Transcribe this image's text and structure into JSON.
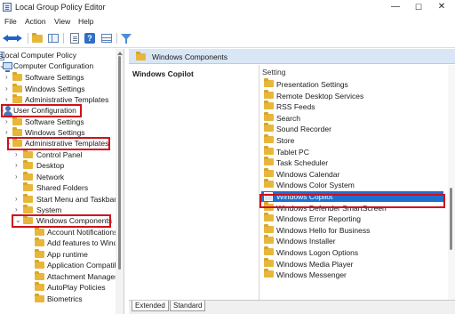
{
  "window": {
    "title": "Local Group Policy Editor",
    "minimize": "—",
    "maximize": "☐",
    "close": "✕"
  },
  "menu": [
    "File",
    "Action",
    "View",
    "Help"
  ],
  "toolbar": [
    "back-icon",
    "forward-icon",
    "folder-up-icon",
    "show-hide-tree-icon",
    "properties-icon",
    "help-icon",
    "table-view-icon",
    "filter-icon"
  ],
  "tree": {
    "root": "Local Computer Policy",
    "computer_config": "Computer Configuration",
    "cc_software": "Software Settings",
    "cc_windows": "Windows Settings",
    "cc_admin": "Administrative Templates",
    "user_config": "User Configuration",
    "uc_software": "Software Settings",
    "uc_windows": "Windows Settings",
    "uc_admin": "Administrative Templates",
    "children": [
      "Control Panel",
      "Desktop",
      "Network",
      "Shared Folders",
      "Start Menu and Taskbar",
      "System"
    ],
    "windows_components": "Windows Components",
    "wc_children": [
      "Account Notifications",
      "Add features to Windows",
      "App runtime",
      "Application Compatibility",
      "Attachment Manager",
      "AutoPlay Policies",
      "Biometrics"
    ]
  },
  "right": {
    "header_title": "Windows Components",
    "desc_title": "Windows Copilot",
    "column_header": "Setting",
    "items": [
      "Presentation Settings",
      "Remote Desktop Services",
      "RSS Feeds",
      "Search",
      "Sound Recorder",
      "Store",
      "Tablet PC",
      "Task Scheduler",
      "Windows Calendar",
      "Windows Color System",
      "Windows Copilot",
      "Windows Defender SmartScreen",
      "Windows Error Reporting",
      "Windows Hello for Business",
      "Windows Installer",
      "Windows Logon Options",
      "Windows Media Player",
      "Windows Messenger"
    ],
    "selected": "Windows Copilot"
  },
  "tabs": {
    "extended": "Extended",
    "standard": "Standard"
  },
  "colors": {
    "selection": "#1f6fd0",
    "highlight_box": "#d0101b",
    "header_band": "#d9e6f5"
  }
}
